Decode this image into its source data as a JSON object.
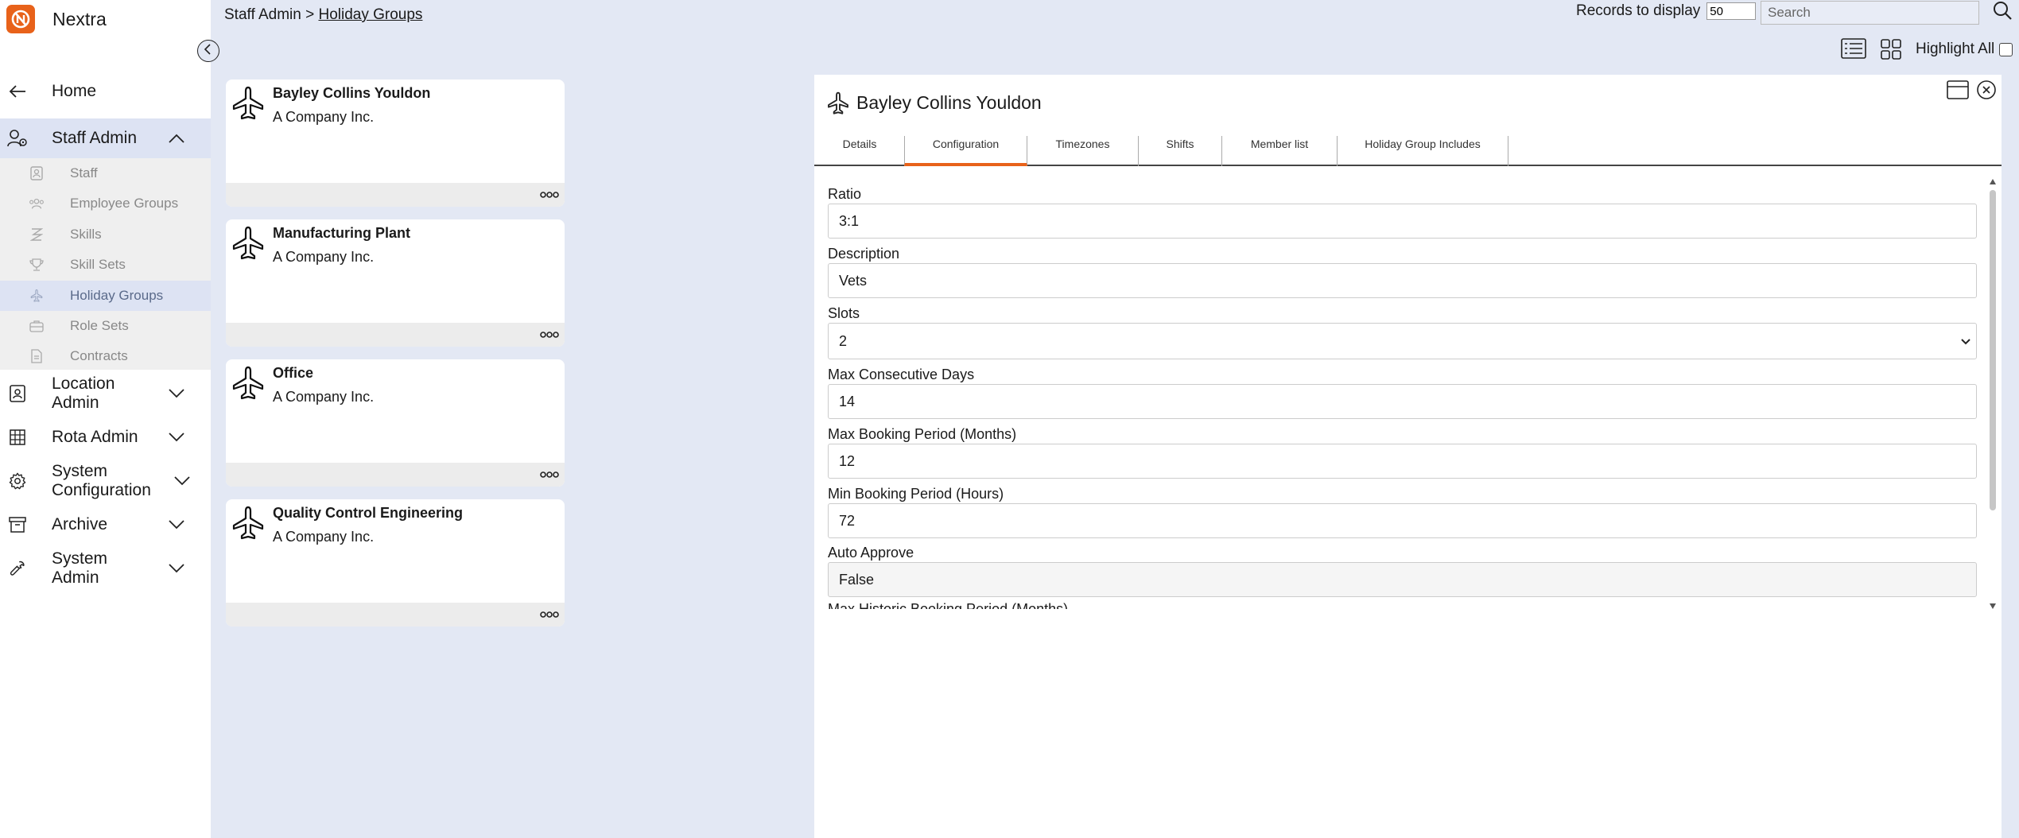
{
  "app": {
    "name": "Nextra",
    "logo_icon": "nextra-logo-icon",
    "accent": "#e8621a"
  },
  "nav": {
    "home": "Home",
    "staff_admin": "Staff Admin",
    "sub_items": [
      {
        "label": "Staff",
        "icon": "staff-icon"
      },
      {
        "label": "Employee Groups",
        "icon": "people-icon"
      },
      {
        "label": "Skills",
        "icon": "skills-icon"
      },
      {
        "label": "Skill Sets",
        "icon": "trophy-icon"
      },
      {
        "label": "Holiday Groups",
        "icon": "plane-icon"
      },
      {
        "label": "Role Sets",
        "icon": "briefcase-icon"
      },
      {
        "label": "Contracts",
        "icon": "document-icon"
      }
    ],
    "location_admin": "Location Admin",
    "rota_admin": "Rota Admin",
    "system_configuration": "System Configuration",
    "archive": "Archive",
    "system_admin": "System Admin"
  },
  "breadcrumb": {
    "root": "Staff Admin",
    "separator": " > ",
    "current": "Holiday Groups"
  },
  "toolbar": {
    "records_label": "Records to display",
    "records_value": "50",
    "search_placeholder": "Search",
    "highlight_label": "Highlight All"
  },
  "cards": [
    {
      "title": "Bayley Collins Youldon",
      "subtitle": "A Company Inc."
    },
    {
      "title": "Manufacturing Plant",
      "subtitle": "A Company Inc."
    },
    {
      "title": "Office",
      "subtitle": "A Company Inc."
    },
    {
      "title": "Quality Control Engineering",
      "subtitle": "A Company Inc."
    }
  ],
  "detail": {
    "title": "Bayley Collins Youldon",
    "tabs": [
      "Details",
      "Configuration",
      "Timezones",
      "Shifts",
      "Member list",
      "Holiday Group Includes"
    ],
    "active_tab": "Configuration",
    "fields": [
      {
        "label": "Ratio",
        "value": "3:1"
      },
      {
        "label": "Description",
        "value": "Vets"
      },
      {
        "label": "Slots",
        "value": "2"
      },
      {
        "label": "Max Consecutive Days",
        "value": "14"
      },
      {
        "label": "Max Booking Period (Months)",
        "value": "12"
      },
      {
        "label": "Min Booking Period (Hours)",
        "value": "72"
      },
      {
        "label": "Auto Approve",
        "value": "False"
      },
      {
        "label": "Max Historic Booking Period (Months)",
        "value": ""
      }
    ]
  }
}
